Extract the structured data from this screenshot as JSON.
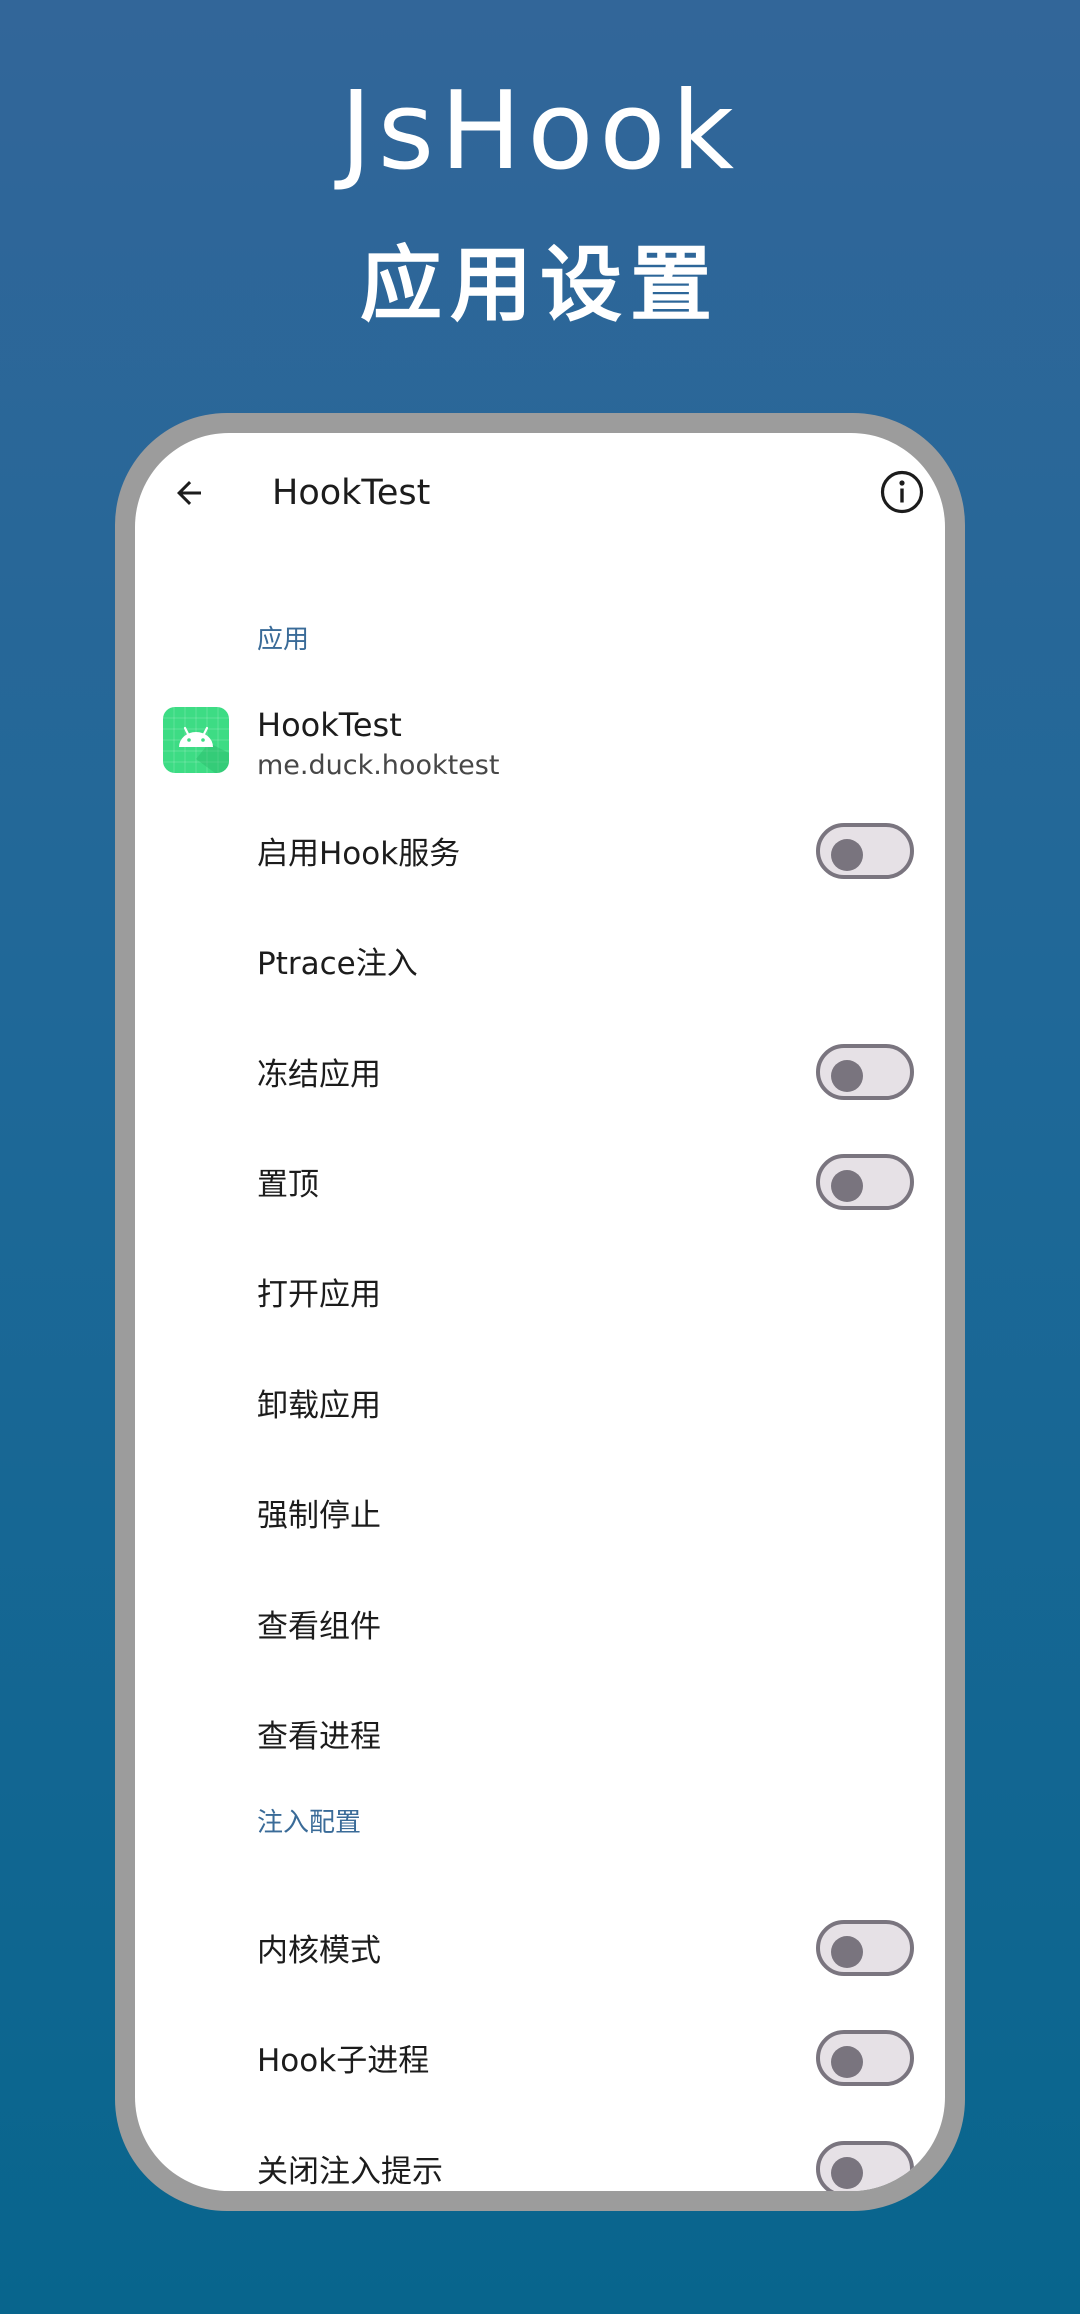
{
  "promo": {
    "title": "JsHook",
    "subtitle": "应用设置"
  },
  "toolbar": {
    "back_icon": "arrow-back-icon",
    "title": "HookTest",
    "info_icon": "info-icon"
  },
  "sections": {
    "app_header": "应用",
    "inject_header": "注入配置"
  },
  "app": {
    "icon": "android-app-icon",
    "name": "HookTest",
    "package": "me.duck.hooktest"
  },
  "prefs": {
    "enable_hook": {
      "label": "启用Hook服务",
      "checked": false
    },
    "ptrace": {
      "label": "Ptrace注入"
    },
    "freeze": {
      "label": "冻结应用",
      "checked": false
    },
    "pin_top": {
      "label": "置顶",
      "checked": false
    },
    "open_app": {
      "label": "打开应用"
    },
    "uninstall": {
      "label": "卸载应用"
    },
    "force_stop": {
      "label": "强制停止"
    },
    "view_components": {
      "label": "查看组件"
    },
    "view_processes": {
      "label": "查看进程"
    },
    "kernel_mode": {
      "label": "内核模式",
      "checked": false
    },
    "hook_child": {
      "label": "Hook子进程",
      "checked": false
    },
    "close_inject_tip": {
      "label": "关闭注入提示",
      "checked": false
    }
  },
  "colors": {
    "accent": "#3a6b98",
    "background_top": "#326699",
    "background_bottom": "#08658d",
    "app_icon": "#3ddc84"
  }
}
